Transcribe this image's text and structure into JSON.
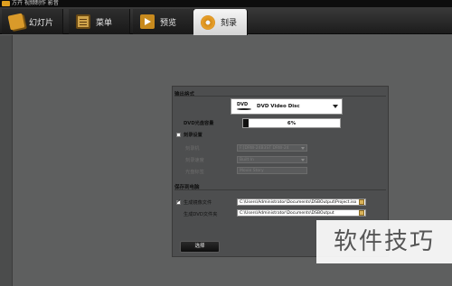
{
  "window": {
    "title": "方卉 视频制作 影音"
  },
  "tabs": [
    {
      "label": "幻灯片",
      "icon": "slides-icon",
      "active": false
    },
    {
      "label": "菜单",
      "icon": "menu-icon",
      "active": false
    },
    {
      "label": "预览",
      "icon": "preview-icon",
      "active": false
    },
    {
      "label": "刻录",
      "icon": "burn-disc-icon",
      "active": true
    }
  ],
  "output": {
    "section_title": "输出格式",
    "format_value": "DVD Video Disc",
    "dvd_logo": "DVD",
    "capacity_label": "DVD光盘容量",
    "capacity_percent_text": "6%",
    "capacity_percent": 6
  },
  "burn_settings": {
    "checkbox_label": "刻录设置",
    "checked": false,
    "drive_label": "刻录机",
    "drive_value": "F:[DRW-24B3ST    DRW-24",
    "speed_label": "刻录速度",
    "speed_value": "Built In",
    "disc_label": "光盘标签",
    "disc_value": "Movie Story"
  },
  "save": {
    "section_title": "保存到电脑",
    "iso_checkbox_label": "生成镜像文件",
    "iso_checked": true,
    "iso_path": "C:\\Users\\Administrator\\Documents\\DSBOutput\\Project.iso",
    "dvd_folder_label": "生成DVD文件夹",
    "dvd_folder_path": "C:\\Users\\Administrator\\Documents\\DSBOutput"
  },
  "actions": {
    "select_label": "选择"
  },
  "watermark": {
    "text": "软件技巧"
  },
  "colors": {
    "background": "#5e5f5f",
    "panel": "#4d4e4f",
    "tab_active": "#e6e6e6",
    "titlebar": "#0d0d0d"
  }
}
